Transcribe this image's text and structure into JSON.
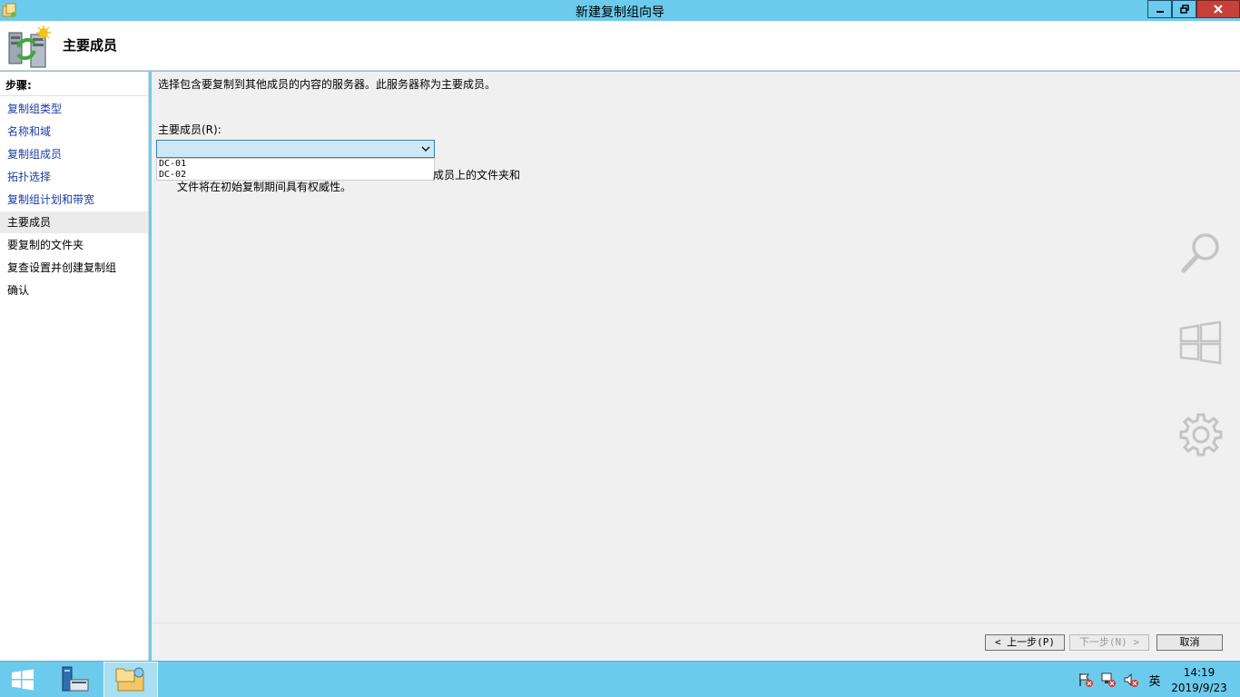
{
  "window": {
    "title": "新建复制组向导"
  },
  "header": {
    "page_title": "主要成员"
  },
  "sidebar": {
    "heading": "步骤:",
    "steps": [
      {
        "label": "复制组类型",
        "state": "done"
      },
      {
        "label": "名称和域",
        "state": "done"
      },
      {
        "label": "复制组成员",
        "state": "done"
      },
      {
        "label": "拓扑选择",
        "state": "done"
      },
      {
        "label": "复制组计划和带宽",
        "state": "done"
      },
      {
        "label": "主要成员",
        "state": "current"
      },
      {
        "label": "要复制的文件夹",
        "state": "future"
      },
      {
        "label": "复查设置并创建复制组",
        "state": "future"
      },
      {
        "label": "确认",
        "state": "future"
      }
    ]
  },
  "main": {
    "description": "选择包含要复制到其他成员的内容的服务器。此服务器称为主要成员。",
    "primary_member_label": "主要成员(R):",
    "combo_value": "",
    "options": [
      "DC-01",
      "DC-02"
    ],
    "note_line1_tail": "成员上的文件夹和",
    "note_line2": "文件将在初始复制期间具有权威性。"
  },
  "buttons": {
    "prev": "< 上一步(P)",
    "next": "下一步(N) >",
    "cancel": "取消"
  },
  "taskbar": {
    "ime": "英",
    "time": "14:19",
    "date": "2019/9/23"
  },
  "icons": {
    "search_charm": "search-icon",
    "start_charm": "windows-logo-icon",
    "settings_charm": "gear-icon"
  },
  "colors": {
    "titlebar": "#6ccbec",
    "close_button": "#c7403a",
    "link": "#1a3ca6",
    "combo_selected": "#cce8f4"
  }
}
